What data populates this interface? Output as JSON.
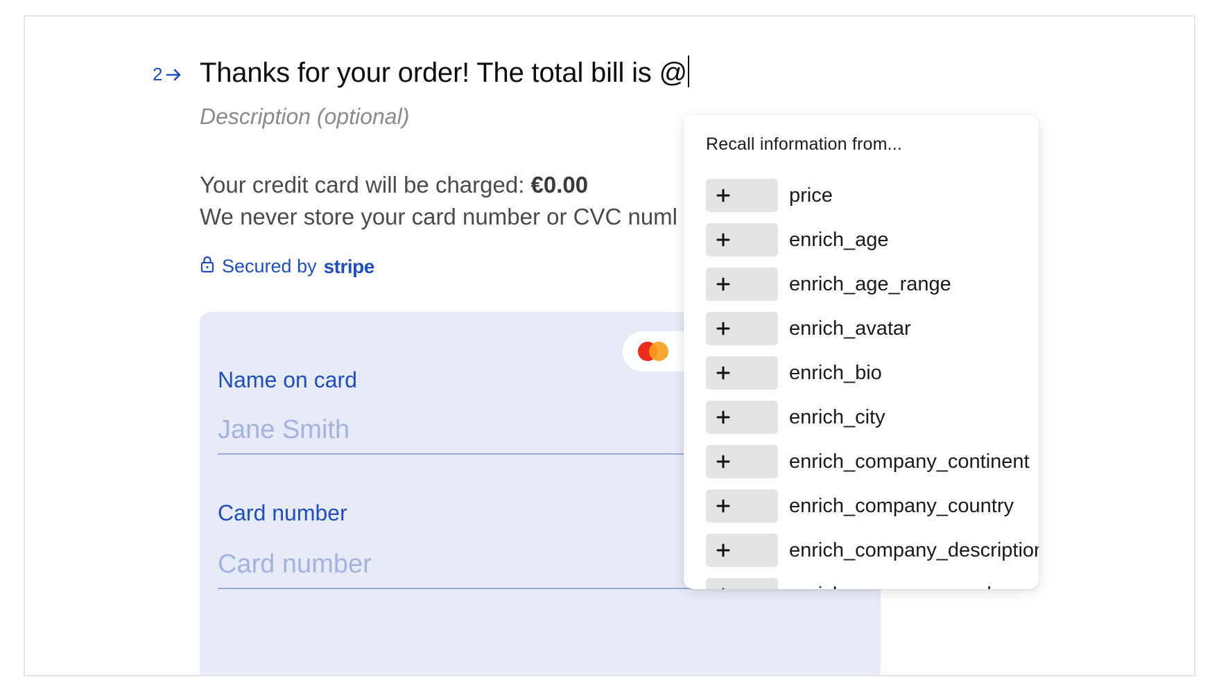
{
  "question": {
    "number": "2",
    "title": "Thanks for your order! The total bill is @",
    "description_placeholder": "Description (optional)"
  },
  "payment": {
    "charge_prefix": "Your credit card will be charged: ",
    "charge_amount": "€0.00",
    "store_notice": "We never store your card number or CVC numl",
    "secured_by": "Secured by",
    "stripe_word": "stripe"
  },
  "card_form": {
    "name_label": "Name on card",
    "name_placeholder": "Jane Smith",
    "number_label": "Card number",
    "number_placeholder": "Card number"
  },
  "recall": {
    "heading": "Recall information from...",
    "items": [
      {
        "label": "price"
      },
      {
        "label": "enrich_age"
      },
      {
        "label": "enrich_age_range"
      },
      {
        "label": "enrich_avatar"
      },
      {
        "label": "enrich_bio"
      },
      {
        "label": "enrich_city"
      },
      {
        "label": "enrich_company_continent"
      },
      {
        "label": "enrich_company_country"
      },
      {
        "label": "enrich_company_description"
      },
      {
        "label": "enrich_company_employees"
      }
    ]
  },
  "colors": {
    "accent_blue": "#1d4fc0",
    "panel_bg": "#e7ebf7",
    "card_red": "#eb2b1b",
    "card_orange": "#f79e1b"
  }
}
